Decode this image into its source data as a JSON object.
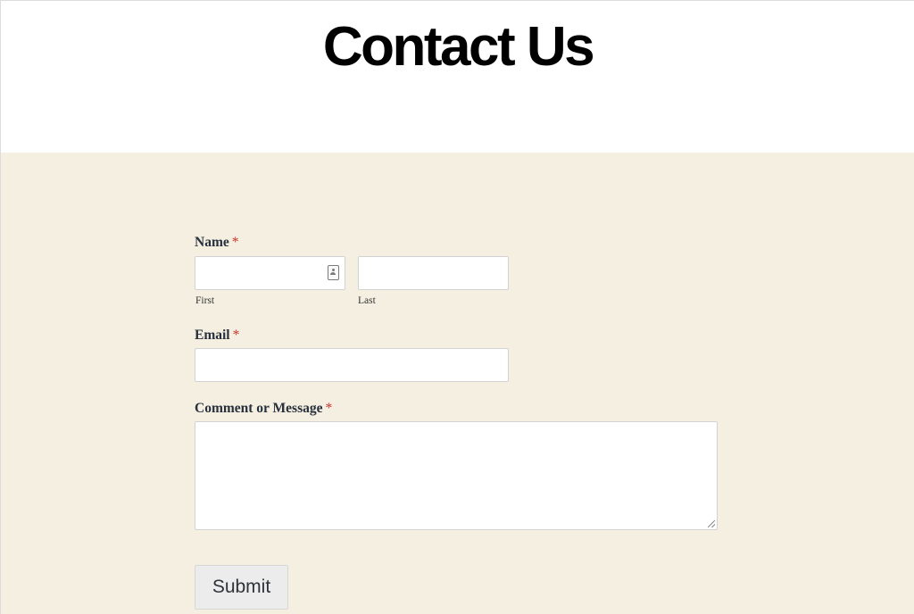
{
  "page": {
    "title": "Contact Us"
  },
  "form": {
    "name": {
      "label": "Name",
      "required_marker": "*",
      "first_sublabel": "First",
      "last_sublabel": "Last",
      "first_value": "",
      "last_value": "",
      "first_icon": "contact-card-icon"
    },
    "email": {
      "label": "Email",
      "required_marker": "*",
      "value": ""
    },
    "message": {
      "label": "Comment or Message",
      "required_marker": "*",
      "value": ""
    },
    "submit_label": "Submit"
  },
  "colors": {
    "form_background": "#f4efe0",
    "required": "#c8322a",
    "button_background": "#ececec"
  }
}
